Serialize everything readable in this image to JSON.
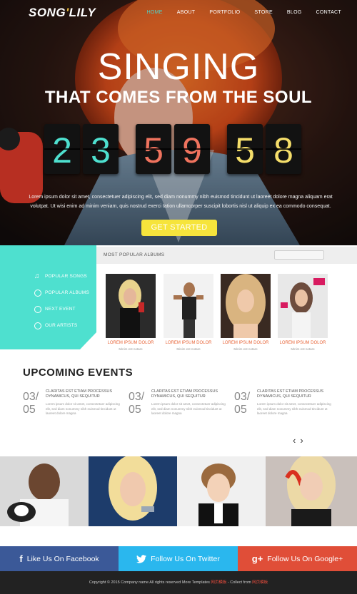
{
  "brand": {
    "logo_main": "SONG",
    "logo_amp": "'",
    "logo_end": "LILY"
  },
  "nav": {
    "items": [
      "HOME",
      "ABOUT",
      "PORTFOLIO",
      "STORE",
      "BLOG",
      "CONTACT"
    ],
    "active": 0
  },
  "hero": {
    "title": "SINGING",
    "subtitle": "THAT COMES FROM THE SOUL",
    "countdown": [
      {
        "digit": "2",
        "color": "#4ee0cf"
      },
      {
        "digit": "3",
        "color": "#4ee0cf"
      },
      {
        "digit": "5",
        "color": "#f0735e"
      },
      {
        "digit": "9",
        "color": "#f0735e"
      },
      {
        "digit": "5",
        "color": "#f5de6a"
      },
      {
        "digit": "8",
        "color": "#f5de6a"
      }
    ],
    "description": "Lorem ipsum dolor sit amet, consectetuer adipiscing elit, sed diam nonummy nibh euismod tincidunt ut laoreet dolore magna aliquam erat volutpat. Ut wisi enim ad minim veniam, quis nostrud exerci tation ullamcorper suscipit lobortis nisl ut aliquip ex ea commodo consequat.",
    "cta_label": "GET STARTED"
  },
  "sidebar": {
    "items": [
      {
        "label": "POPULAR SONGS",
        "icon": "music-note-icon"
      },
      {
        "label": "POPULAR ALBUMS",
        "icon": "disc-icon"
      },
      {
        "label": "NEXT EVENT",
        "icon": "calendar-icon"
      },
      {
        "label": "OUR ARTISTS",
        "icon": "mic-icon"
      }
    ]
  },
  "albums": {
    "title": "MOST POPULAR ALBUMS",
    "items": [
      {
        "name": "LOREM IPSUM DOLOR",
        "sub": "Minim est notare"
      },
      {
        "name": "LOREM IPSUM DOLOR",
        "sub": "Minim est notare"
      },
      {
        "name": "LOREM IPSUM DOLOR",
        "sub": "Minim est notare"
      },
      {
        "name": "LOREM IPSUM DOLOR",
        "sub": "Minim est notare"
      }
    ]
  },
  "events": {
    "title": "UPCOMING EVENTS",
    "items": [
      {
        "day": "03/",
        "month": "05",
        "title": "CLARITAS EST ETIAM PROCESSUS DYNAMICUS, QUI SEQUITUR",
        "text": "Lorem ipsum dolor sit amet, consectetuer adipiscing elit, sed diam nonummy nibh euismod tincidunt ut laoreet dolore magna"
      },
      {
        "day": "03/",
        "month": "05",
        "title": "CLARITAS EST ETIAM PROCESSUS DYNAMICUS, QUI SEQUITUR",
        "text": "Lorem ipsum dolor sit amet, consectetuer adipiscing elit, sed diam nonummy nibh euismod tincidunt ut laoreet dolore magna"
      },
      {
        "day": "03/",
        "month": "05",
        "title": "CLARITAS EST ETIAM PROCESSUS DYNAMICUS, QUI SEQUITUR",
        "text": "Lorem ipsum dolor sit amet, consectetuer adipiscing elit, sed diam nonummy nibh euismod tincidunt ut laoreet dolore magna"
      }
    ],
    "prev_label": "‹",
    "next_label": "›"
  },
  "social": {
    "facebook": {
      "label": "Like Us On Facebook",
      "icon": "f",
      "color": "#3b5998"
    },
    "twitter": {
      "label": "Follow Us On Twitter",
      "icon": "twitter-bird-icon",
      "color": "#2ab7ee"
    },
    "google": {
      "label": "Follow Us On Google+",
      "icon": "g+",
      "color": "#e04e38"
    }
  },
  "footer": {
    "text": "Copyright © 2015 Company name All rights reserved More Templates",
    "link1": "网页模板",
    "sep": " - Collect from ",
    "link2": "网页模板"
  }
}
